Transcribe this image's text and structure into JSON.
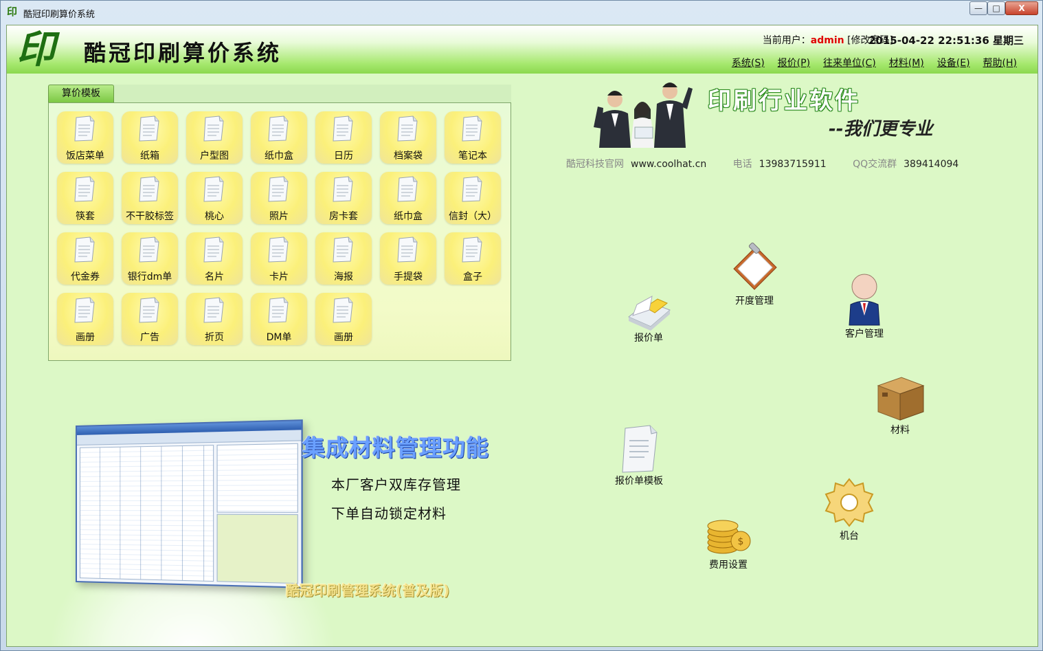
{
  "window": {
    "title": "酷冠印刷算价系统",
    "icon_glyph": "印",
    "buttons": {
      "minimize": "—",
      "maximize": "□",
      "close": "X"
    }
  },
  "header": {
    "logo_glyph": "印",
    "app_title": "酷冠印刷算价系统",
    "user_label": "当前用户：",
    "user_name": "admin",
    "change_password": "[修改密码]",
    "datetime": "2015-04-22 22:51:36 星期三"
  },
  "menu": [
    {
      "label": "系统(S)"
    },
    {
      "label": "报价(P)"
    },
    {
      "label": "往来单位(C)"
    },
    {
      "label": "材料(M)"
    },
    {
      "label": "设备(E)"
    },
    {
      "label": "帮助(H)"
    }
  ],
  "template_panel": {
    "tab_label": "算价模板",
    "items": [
      {
        "label": "饭店菜单"
      },
      {
        "label": "纸箱"
      },
      {
        "label": "户型图"
      },
      {
        "label": "纸巾盒"
      },
      {
        "label": "日历"
      },
      {
        "label": "档案袋"
      },
      {
        "label": "笔记本"
      },
      {
        "label": "筷套"
      },
      {
        "label": "不干胶标签"
      },
      {
        "label": "桃心"
      },
      {
        "label": "照片"
      },
      {
        "label": "房卡套"
      },
      {
        "label": "纸巾盒"
      },
      {
        "label": "信封（大）"
      },
      {
        "label": "代金券"
      },
      {
        "label": "银行dm单"
      },
      {
        "label": "名片"
      },
      {
        "label": "卡片"
      },
      {
        "label": "海报"
      },
      {
        "label": "手提袋"
      },
      {
        "label": "盒子"
      },
      {
        "label": "画册"
      },
      {
        "label": "广告"
      },
      {
        "label": "折页"
      },
      {
        "label": "DM单"
      },
      {
        "label": "画册"
      }
    ]
  },
  "banner": {
    "headline": "印刷行业软件",
    "slogan": "--我们更专业",
    "site_label": "酷冠科技官网",
    "site_value": "www.coolhat.cn",
    "phone_label": "电话",
    "phone_value": "13983715911",
    "qq_label": "QQ交流群",
    "qq_value": "389414094"
  },
  "shortcuts": {
    "quote": "报价单",
    "billing": "开度管理",
    "customer": "客户管理",
    "material": "材料",
    "quote_template": "报价单模板",
    "machine": "机台",
    "fees": "费用设置"
  },
  "promo": {
    "title": "集成材料管理功能",
    "line1": "本厂客户双库存管理",
    "line2": "下单自动锁定材料",
    "footer": "酷冠印刷管理系统(普及版)"
  }
}
